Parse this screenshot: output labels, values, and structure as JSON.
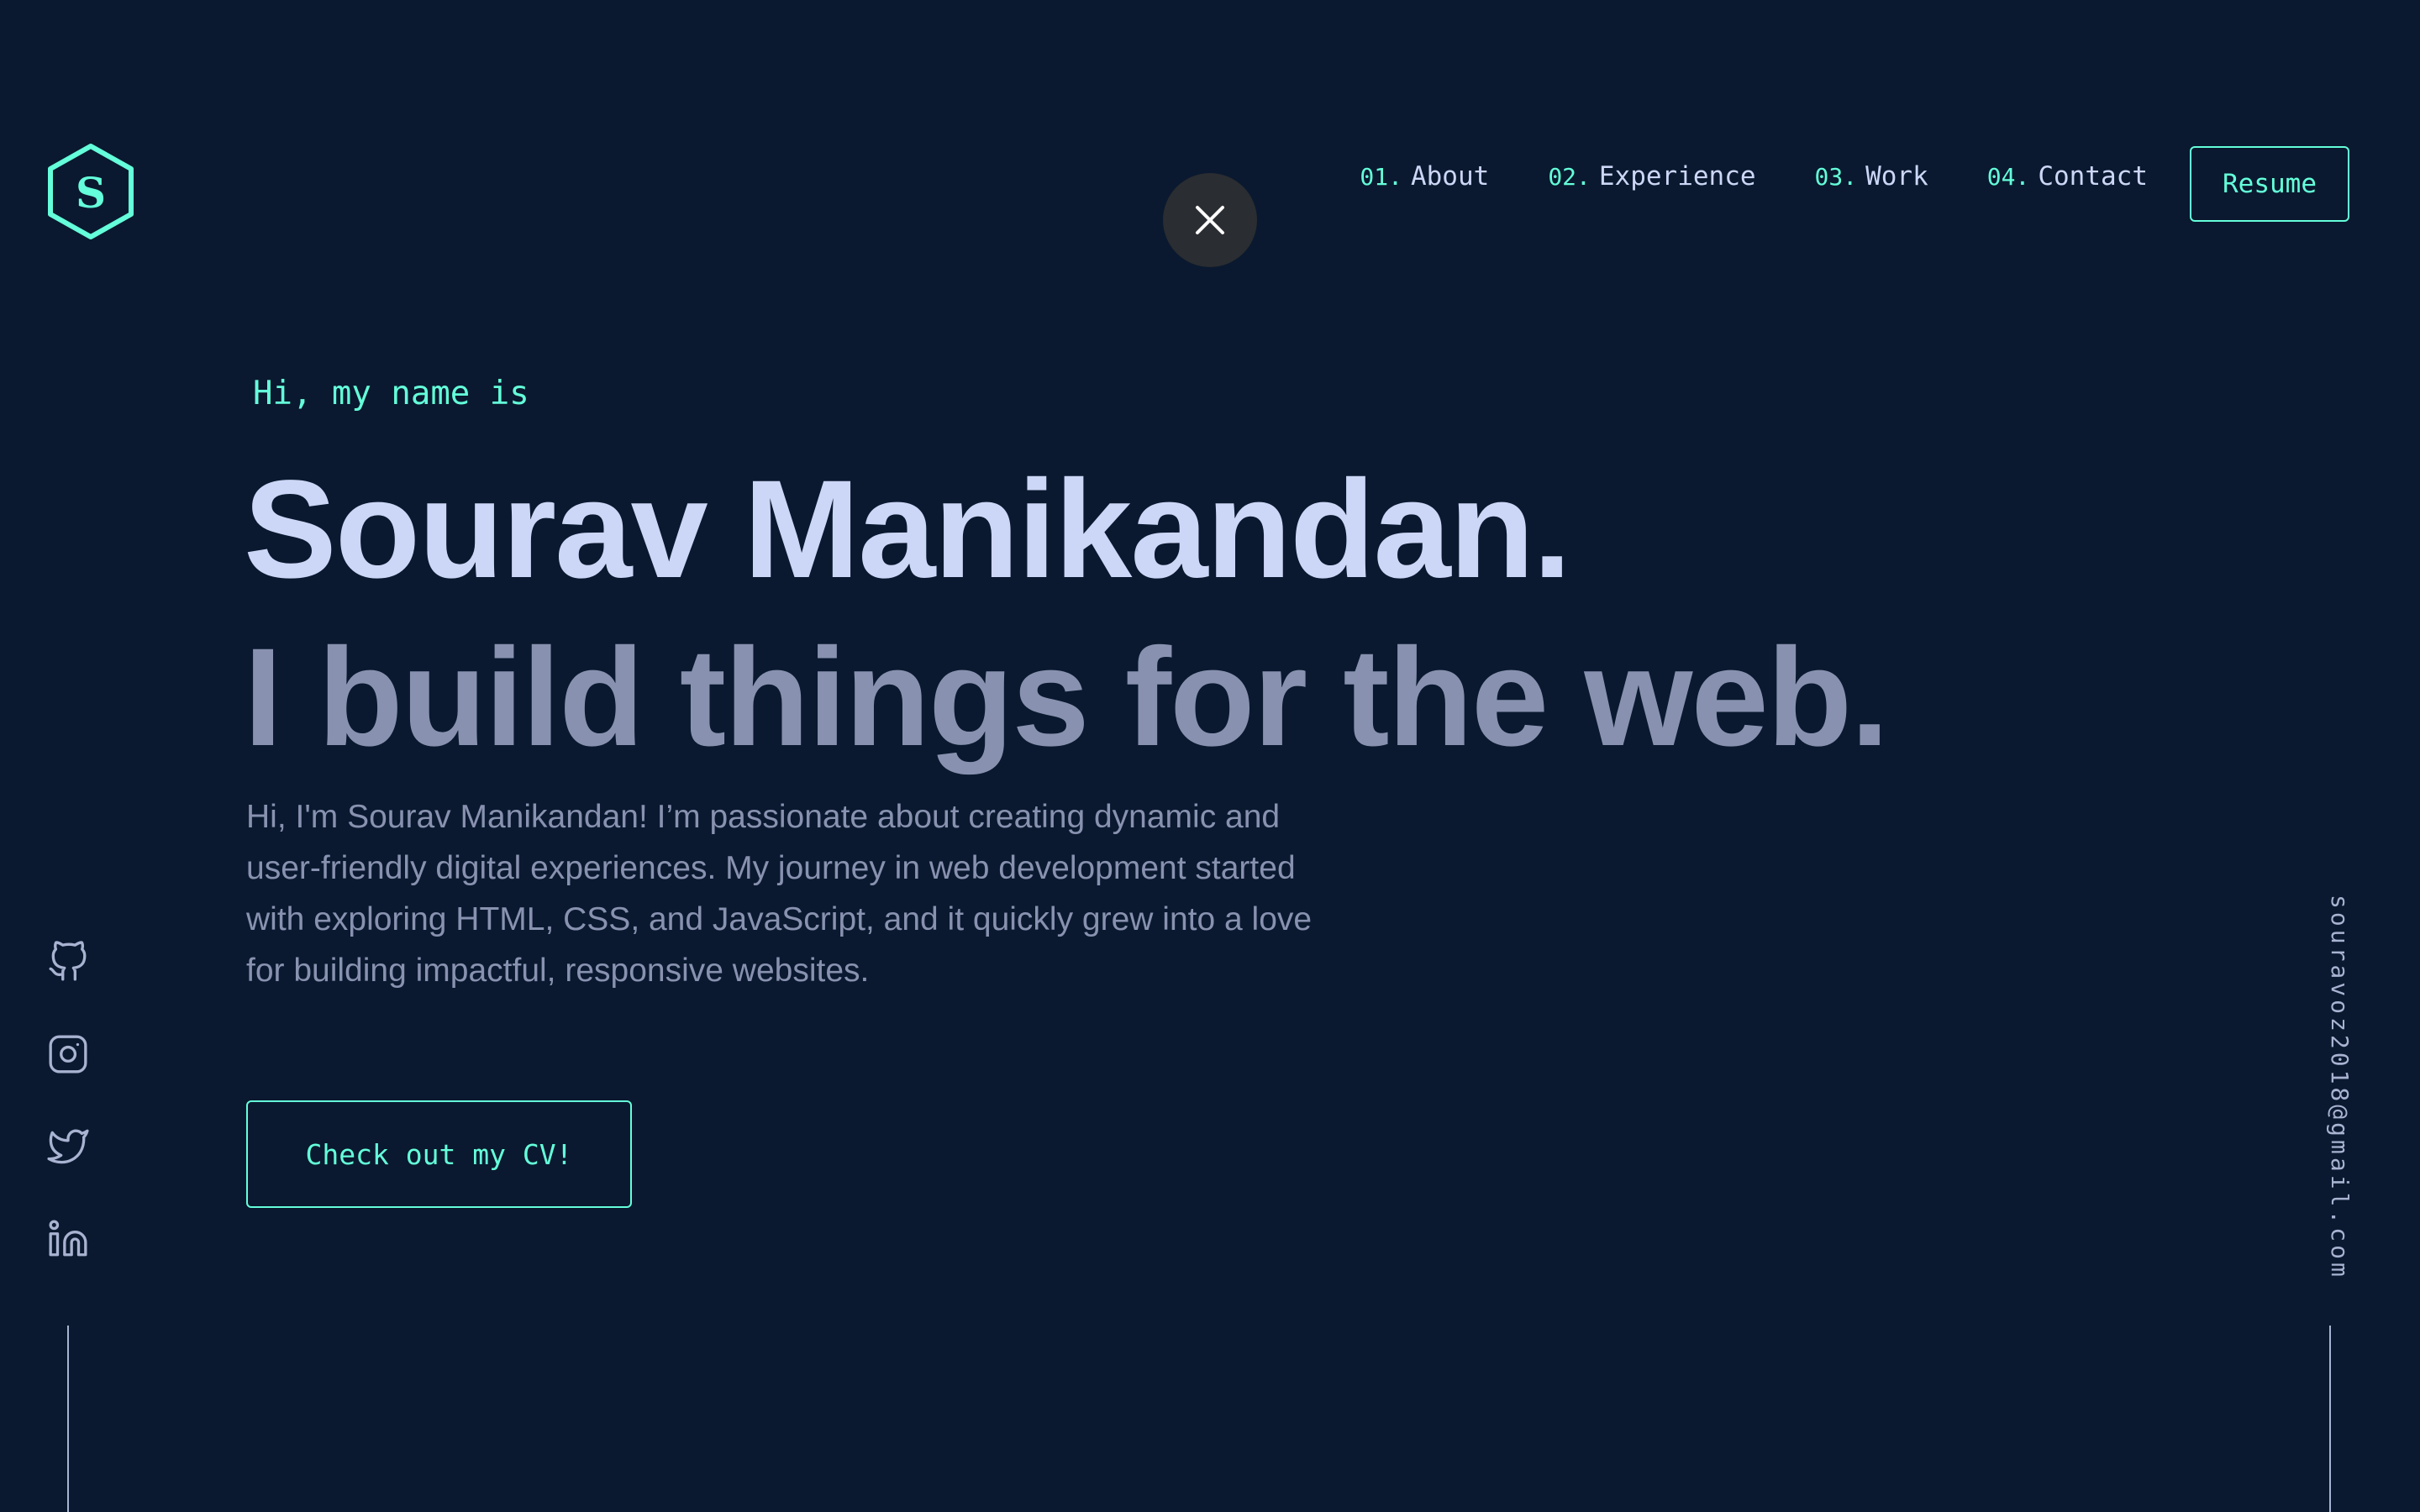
{
  "header": {
    "logo_letter": "S",
    "nav": [
      {
        "num": "01.",
        "label": "About"
      },
      {
        "num": "02.",
        "label": "Experience"
      },
      {
        "num": "03.",
        "label": "Work"
      },
      {
        "num": "04.",
        "label": "Contact"
      }
    ],
    "resume_label": "Resume",
    "close_icon": "close-icon"
  },
  "hero": {
    "intro": "Hi, my name is",
    "name": "Sourav Manikandan.",
    "tagline": "I build things for the web.",
    "bio": "Hi, I'm Sourav Manikandan! I’m passionate about creating dynamic and user-friendly digital experiences. My journey in web development started with exploring HTML, CSS, and JavaScript, and it quickly grew into a love for building impactful, responsive websites.",
    "cta_label": "Check out my CV!"
  },
  "social": {
    "icons": [
      "github-icon",
      "instagram-icon",
      "twitter-icon",
      "linkedin-icon"
    ]
  },
  "email": "souravoz2018@gmail.com",
  "colors": {
    "background": "#0a192f",
    "accent": "#64ffda",
    "heading": "#ccd6f6",
    "muted": "#8892b0"
  }
}
